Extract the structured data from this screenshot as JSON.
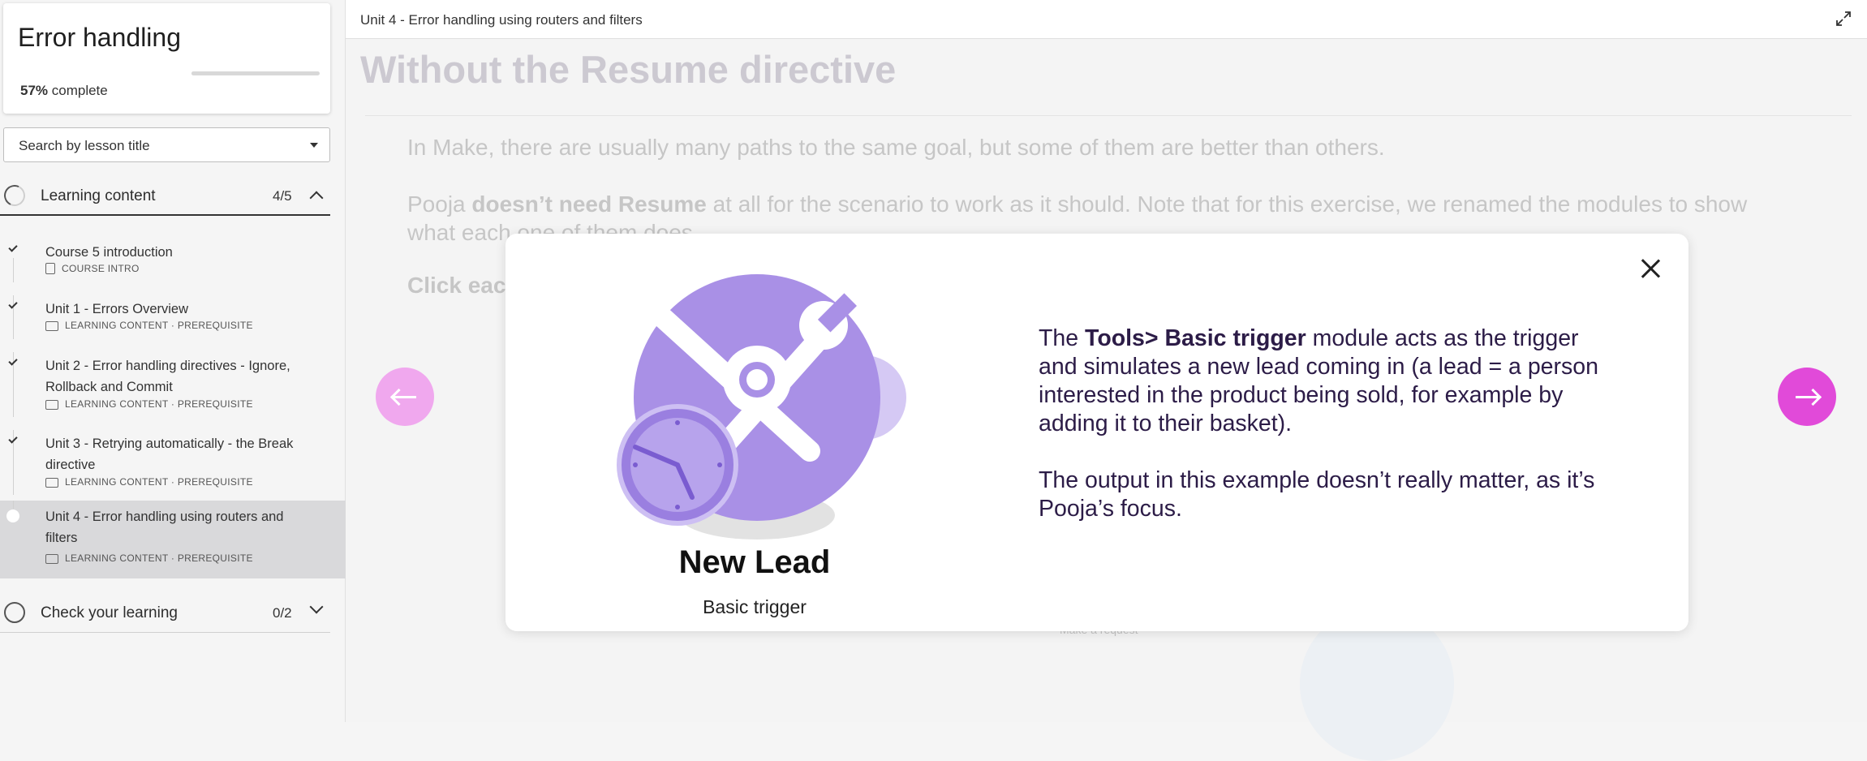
{
  "sidebar": {
    "course_title": "Error handling",
    "progress_percent": "57%",
    "progress_suffix": " complete",
    "progress_fraction": 0.57,
    "search_placeholder": "Search by lesson title",
    "sections": [
      {
        "title": "Learning content",
        "count": "4/5",
        "lessons": [
          {
            "title": "Course 5 introduction",
            "meta": "COURSE INTRO",
            "done": true
          },
          {
            "title": "Unit 1 - Errors Overview",
            "meta": "LEARNING CONTENT · PREREQUISITE",
            "done": true
          },
          {
            "title": "Unit 2 - Error handling directives - Ignore, Rollback and Commit",
            "meta": "LEARNING CONTENT · PREREQUISITE",
            "done": true
          },
          {
            "title": "Unit 3 - Retrying automatically - the Break directive",
            "meta": "LEARNING CONTENT · PREREQUISITE",
            "done": true
          },
          {
            "title": "Unit 4 - Error handling using routers and filters",
            "meta": "LEARNING CONTENT · PREREQUISITE",
            "done": false
          }
        ]
      },
      {
        "title": "Check your learning",
        "count": "0/2"
      }
    ]
  },
  "main": {
    "breadcrumb": "Unit 4 - Error handling using routers and filters",
    "bg_title": "Without the Resume directive",
    "bg_p1": "In Make, there are usually many paths to the same goal, but some of them are better than others.",
    "bg_p2_pre": "Pooja ",
    "bg_p2_bold": "doesn’t need Resume",
    "bg_p2_post": " at all for the scenario to work as it should. Note that for this exercise, we renamed the modules to show what each one of them does.",
    "bg_p3": "Click each",
    "bg_small": "Make a request"
  },
  "modal": {
    "module_name": "New Lead",
    "module_subtitle": "Basic trigger",
    "p1_pre": "The ",
    "p1_bold": "Tools> Basic trigger",
    "p1_post": " module acts as the trigger and simulates a new lead coming in (a lead = a person interested in the product being sold, for example by adding it to their basket).",
    "p2": "The output in this example doesn’t really matter, as it’s Pooja’s focus."
  },
  "colors": {
    "accent": "#e14ad9",
    "accent_light": "#f0a8ee",
    "module_purple": "#a990e6",
    "text_dark_purple": "#2c1c47"
  }
}
